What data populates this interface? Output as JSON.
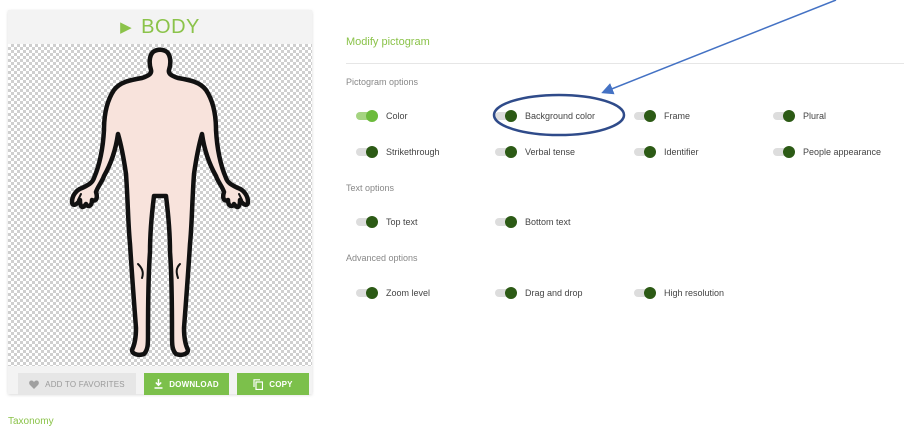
{
  "card": {
    "title": "BODY",
    "buttons": {
      "favorites": "ADD TO FAVORITES",
      "download": "DOWNLOAD",
      "copy": "COPY"
    }
  },
  "modify": {
    "header": "Modify pictogram",
    "pictogram_options": {
      "label": "Pictogram options",
      "items": [
        "Color",
        "Background color",
        "Frame",
        "Plural",
        "Strikethrough",
        "Verbal tense",
        "Identifier",
        "People appearance"
      ],
      "on": [
        true,
        false,
        false,
        false,
        false,
        false,
        false,
        false
      ]
    },
    "text_options": {
      "label": "Text options",
      "items": [
        "Top text",
        "Bottom text"
      ]
    },
    "advanced_options": {
      "label": "Advanced options",
      "items": [
        "Zoom level",
        "Drag and drop",
        "High resolution"
      ]
    }
  },
  "taxonomy": {
    "label": "Taxonomy"
  },
  "colors": {
    "accent": "#8bc34a",
    "button_green": "#7cc04b",
    "toggle_knob_off": "#2c5a15",
    "toggle_knob_on": "#6cbb3c",
    "annotation": "#4472c4",
    "skin": "#f8e3dc"
  },
  "icons": [
    "play-triangle-icon",
    "heart-icon",
    "download-icon",
    "copy-icon"
  ]
}
